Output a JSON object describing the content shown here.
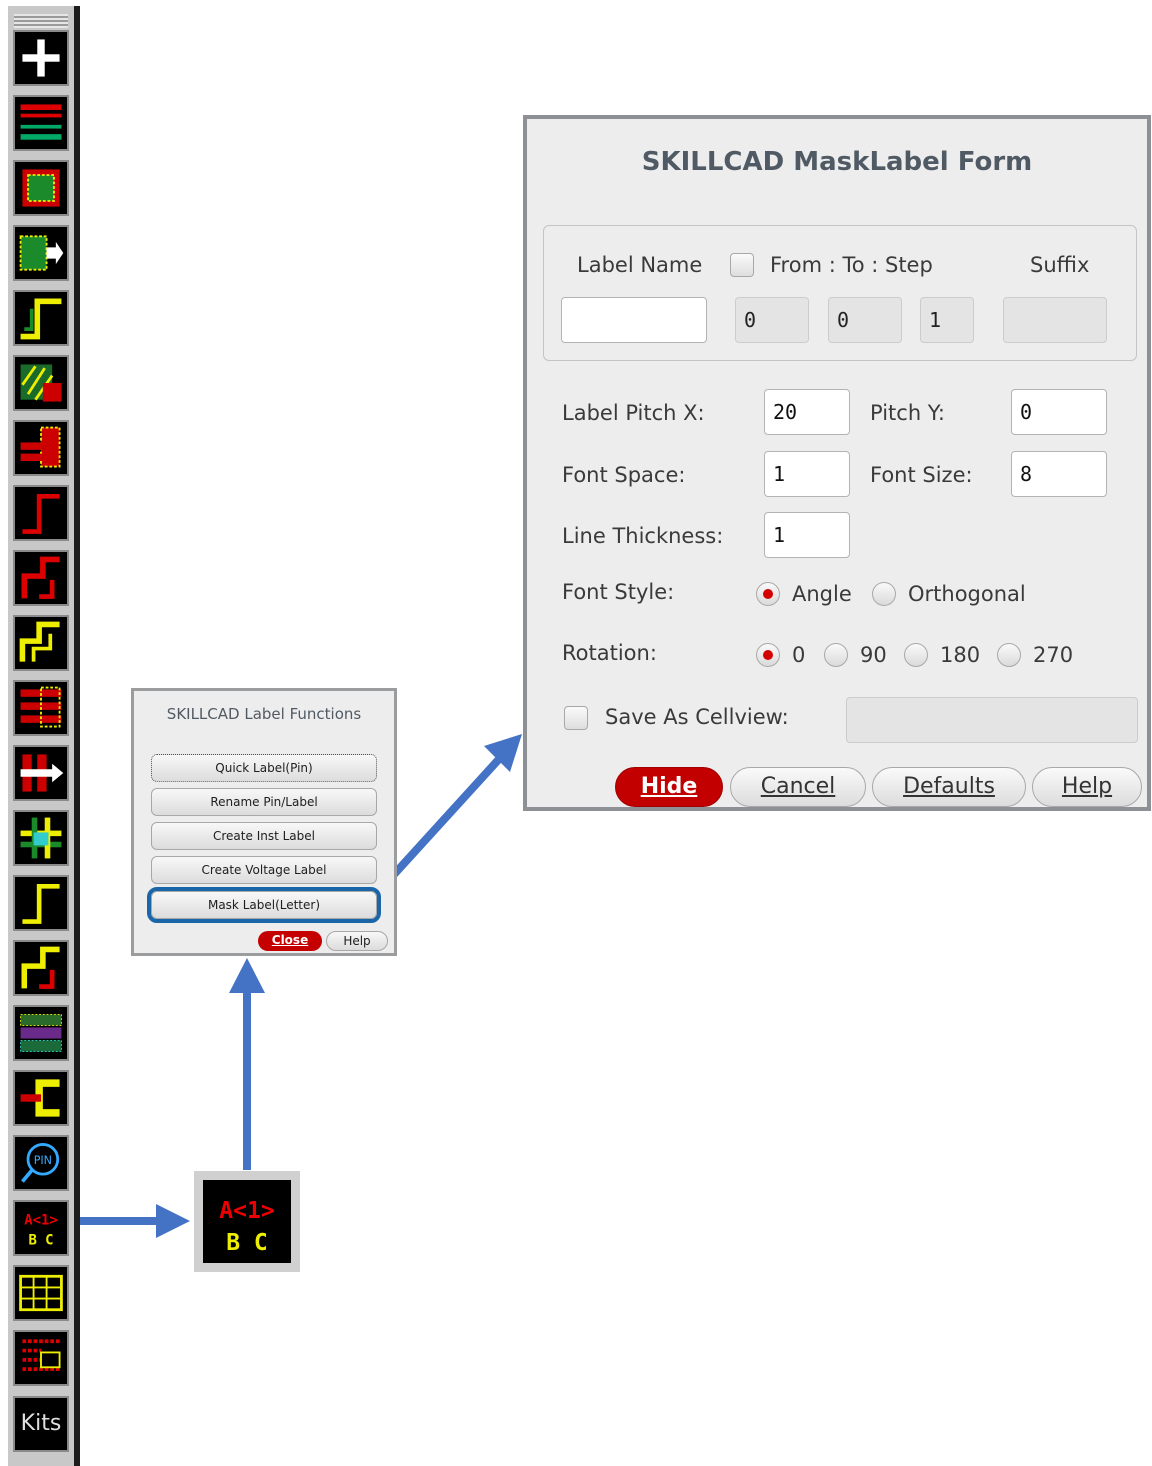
{
  "toolbar": {
    "icons": [
      "plus-icon",
      "layers-lines-icon",
      "fill-square-icon",
      "move-shape-icon",
      "step-path-icon",
      "hatch-shape-icon",
      "stack-shape-icon",
      "step-line-icon",
      "zigzag-red-icon",
      "zigzag-double-icon",
      "bars-icon",
      "split-arrow-icon",
      "cross-grid-icon",
      "step-line-2-icon",
      "zigzag-red-2-icon",
      "pattern-block-icon",
      "bracket-icon",
      "pin-search-icon",
      "label-abc-icon",
      "grid-block-icon",
      "dot-grid-icon"
    ],
    "kits_label": "Kits"
  },
  "zoom_icon": {
    "line1": "A<1>",
    "line2": "B C"
  },
  "label_functions": {
    "title": "SKILLCAD Label Functions",
    "buttons": [
      "Quick Label(Pin)",
      "Rename Pin/Label",
      "Create Inst Label",
      "Create Voltage Label",
      "Mask Label(Letter)"
    ],
    "close_label": "Close",
    "help_label": "Help"
  },
  "mask_form": {
    "title": "SKILLCAD MaskLabel Form",
    "label_name": {
      "label": "Label Name",
      "value": ""
    },
    "range": {
      "label": "From : To : Step",
      "checked": false,
      "from": "0",
      "to": "0",
      "step": "1"
    },
    "suffix": {
      "label": "Suffix",
      "value": ""
    },
    "pitch_x": {
      "label": "Label Pitch X:",
      "value": "20"
    },
    "pitch_y": {
      "label": "Pitch Y:",
      "value": "0"
    },
    "font_space": {
      "label": "Font Space:",
      "value": "1"
    },
    "font_size": {
      "label": "Font Size:",
      "value": "8"
    },
    "line_thickness": {
      "label": "Line Thickness:",
      "value": "1"
    },
    "font_style": {
      "label": "Font Style:",
      "options": [
        "Angle",
        "Orthogonal"
      ],
      "selected": "Angle"
    },
    "rotation": {
      "label": "Rotation:",
      "options": [
        "0",
        "90",
        "180",
        "270"
      ],
      "selected": "0"
    },
    "save_cellview": {
      "label": "Save As Cellview:",
      "checked": false,
      "value": ""
    },
    "buttons": {
      "hide": "Hide",
      "cancel": "Cancel",
      "defaults": "Defaults",
      "help": "Help"
    }
  },
  "colors": {
    "accent_red": "#c20000",
    "highlight_blue": "#1a66a8",
    "arrow_blue": "#4472c4"
  }
}
